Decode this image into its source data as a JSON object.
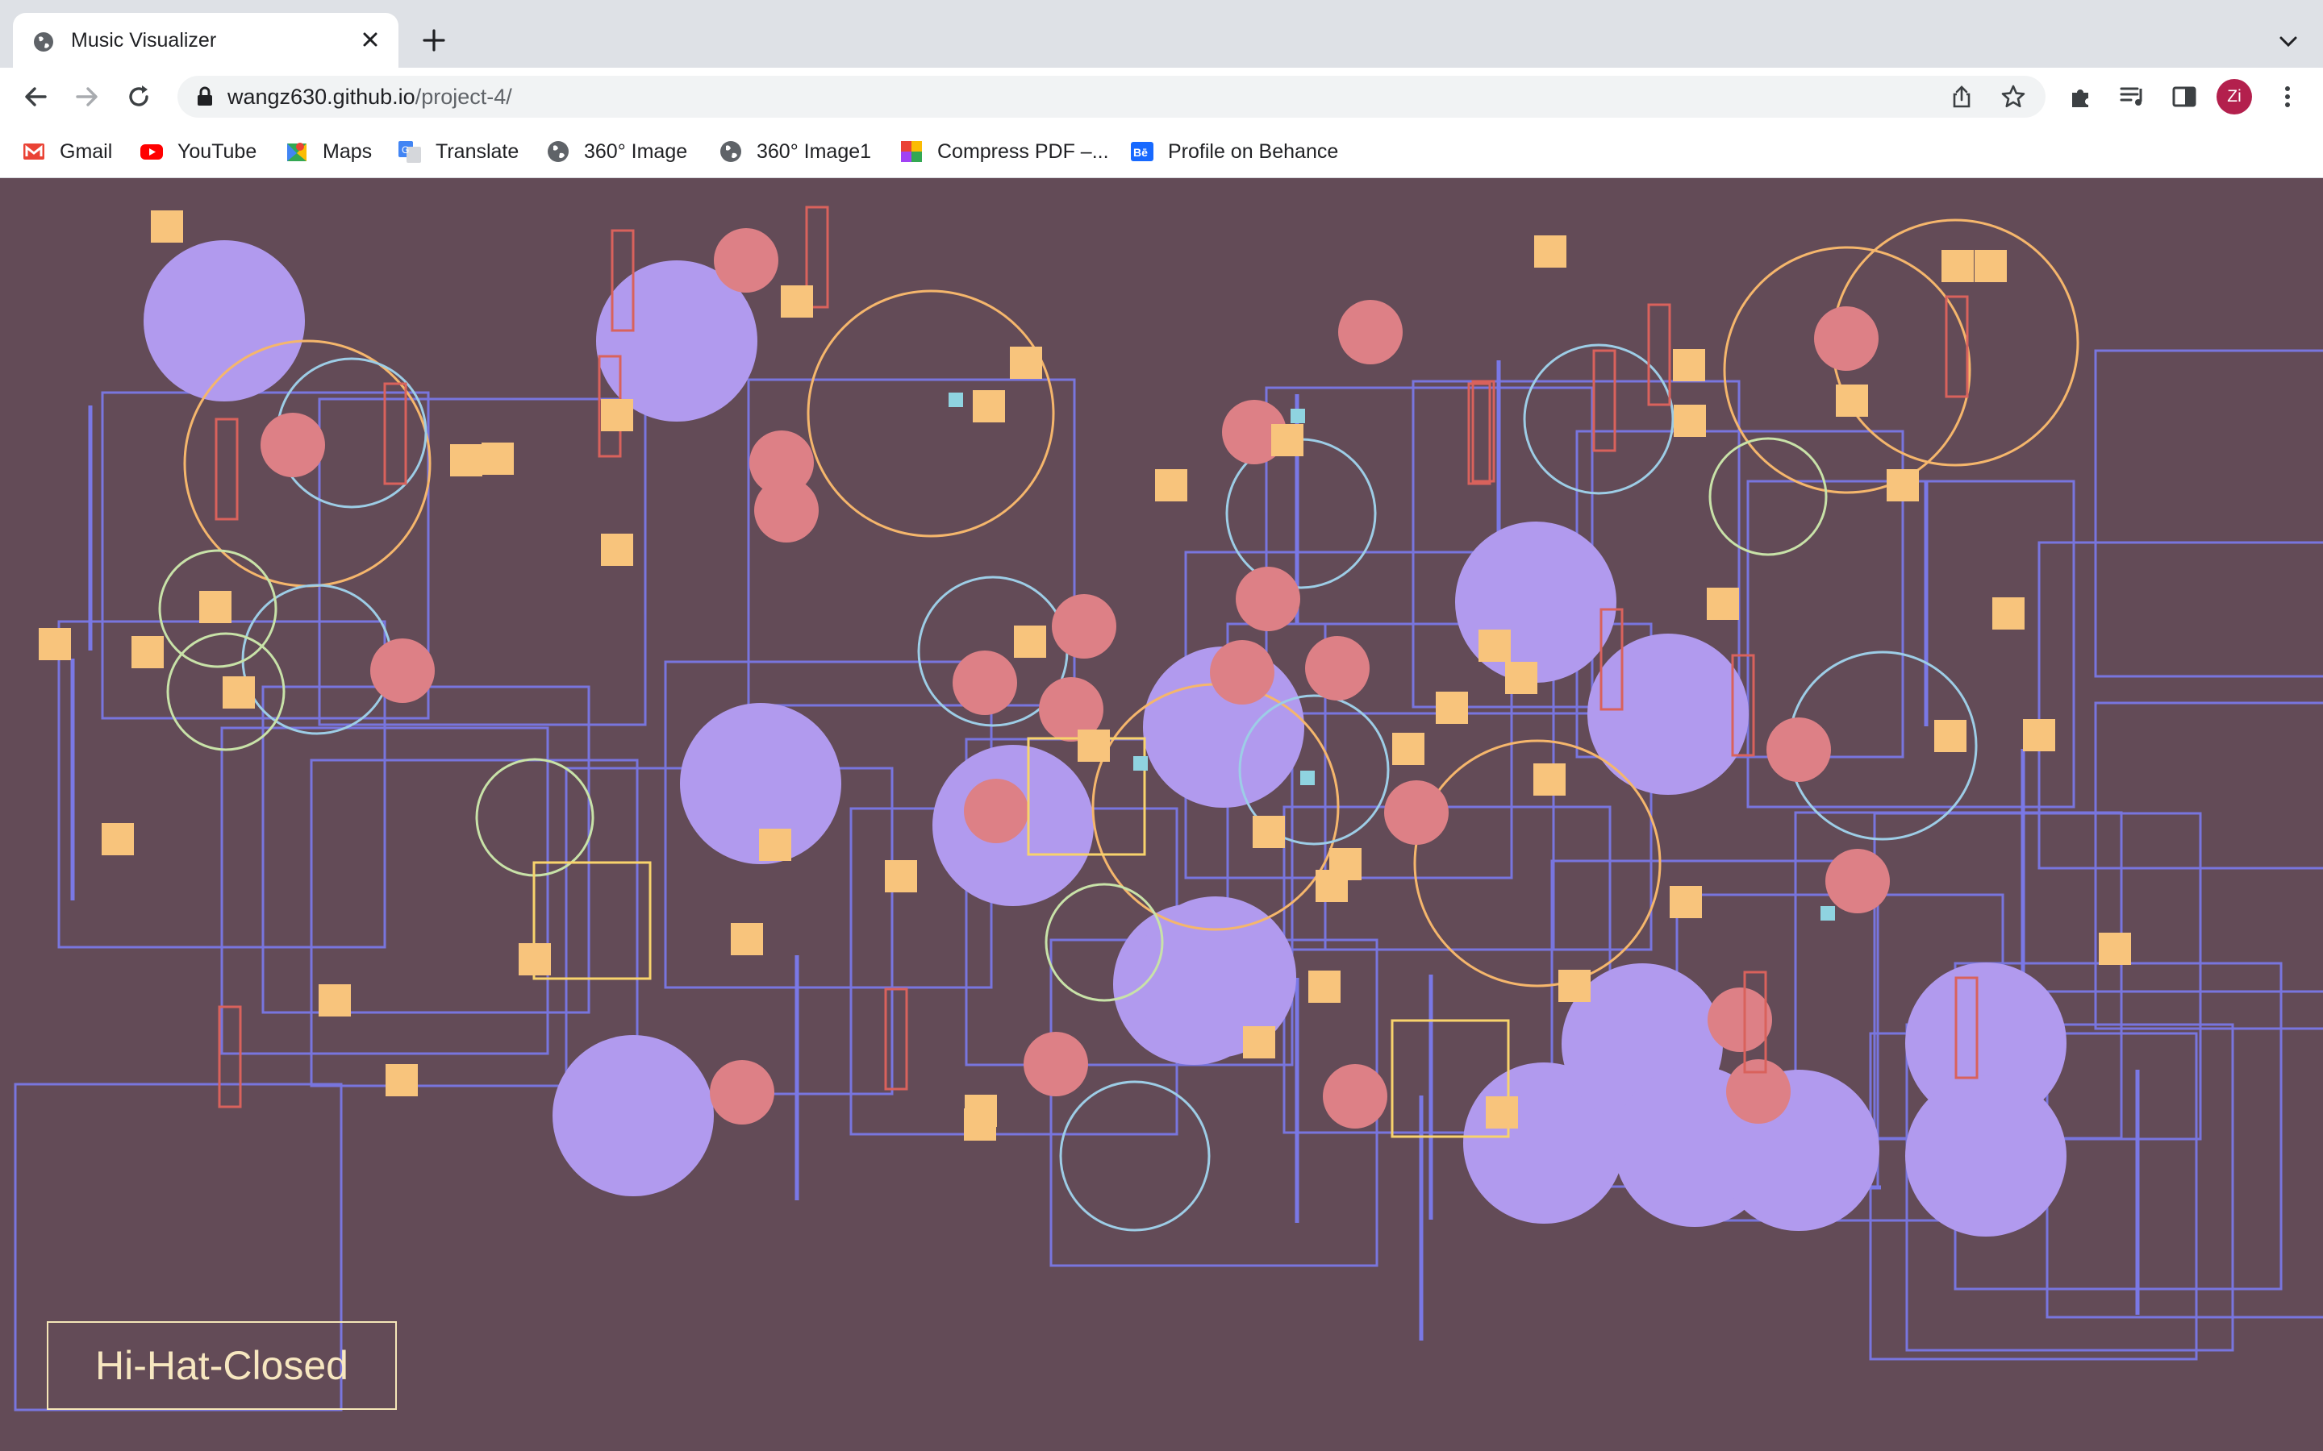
{
  "browser": {
    "tab": {
      "title": "Music Visualizer"
    },
    "address_bar": {
      "host": "wangz630.github.io",
      "path": "/project-4/"
    },
    "profile": {
      "initials": "Zi",
      "color": "#b3204d"
    },
    "bookmarks": [
      {
        "label": "Gmail",
        "icon": "gmail-icon"
      },
      {
        "label": "YouTube",
        "icon": "youtube-icon"
      },
      {
        "label": "Maps",
        "icon": "maps-icon"
      },
      {
        "label": "Translate",
        "icon": "translate-icon"
      },
      {
        "label": "360° Image",
        "icon": "globe-icon"
      },
      {
        "label": "360° Image1",
        "icon": "globe-icon"
      },
      {
        "label": "Compress PDF –...",
        "icon": "compress-pdf-icon"
      },
      {
        "label": "Profile on Behance",
        "icon": "behance-icon"
      }
    ]
  },
  "visualizer": {
    "current_sound": "Hi-Hat-Closed",
    "colors": {
      "background": "#634b57",
      "kick": "#b19aee",
      "snare": "#dd8086",
      "hihat": "#f8c47c",
      "clap_outline": "#7a78e6",
      "ring_orange": "#f5b66c",
      "ring_blue": "#9dcde6",
      "ring_green": "#c8e2a8",
      "bar_red": "#d9625c",
      "box_yellow": "#f8d36c",
      "cyan": "#8fd3e0",
      "label_text": "#f7e7c0"
    }
  }
}
